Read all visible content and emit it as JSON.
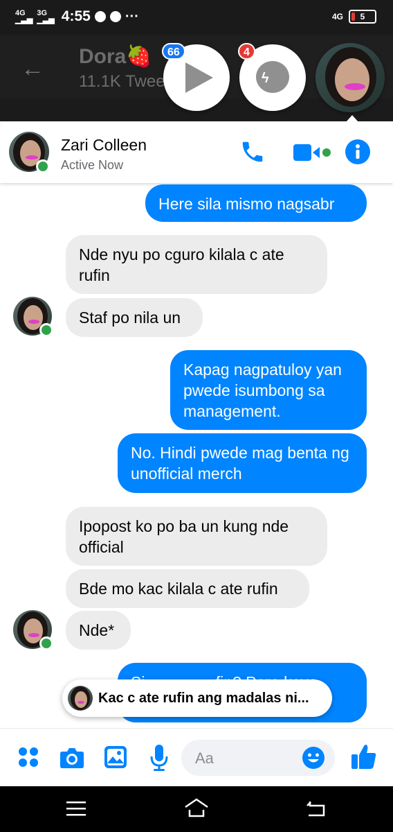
{
  "status_bar": {
    "network_left_1": "4G",
    "network_left_2": "3G",
    "time": "4:55",
    "dots": "···",
    "network_right": "4G",
    "battery": "5"
  },
  "background_app": {
    "title": "Dora🍓",
    "subtitle": "11.1K Twee"
  },
  "chat_heads": [
    {
      "badge": "66",
      "icon": "play-icon"
    },
    {
      "badge": "4",
      "icon": "messenger-icon"
    },
    {
      "icon": "avatar"
    }
  ],
  "header": {
    "name": "Zari Colleen",
    "status": "Active Now"
  },
  "messages": [
    {
      "dir": "out",
      "text": "Here sila mismo nagsabr"
    },
    {
      "dir": "in",
      "text": "Nde nyu po cguro kilala c ate rufin"
    },
    {
      "dir": "in",
      "text": "Staf po nila un"
    },
    {
      "dir": "out",
      "text": "Kapag nagpatuloy yan pwede isumbong sa management."
    },
    {
      "dir": "out",
      "text": "No. Hindi pwede mag benta ng unofficial merch"
    },
    {
      "dir": "in",
      "text": "Ipopost ko po ba un kung nde official"
    },
    {
      "dir": "in",
      "text": "Bde mo kac kilala c ate rufin"
    },
    {
      "dir": "in",
      "text": "Nde*"
    },
    {
      "dir": "out",
      "text": "Si                fin? Paro kayo           min"
    }
  ],
  "toast": {
    "text": "Kac c ate rufin ang madalas ni..."
  },
  "composer": {
    "placeholder": "Aa"
  },
  "colors": {
    "accent": "#0084ff",
    "incoming": "#ececec",
    "online": "#31a24c"
  }
}
